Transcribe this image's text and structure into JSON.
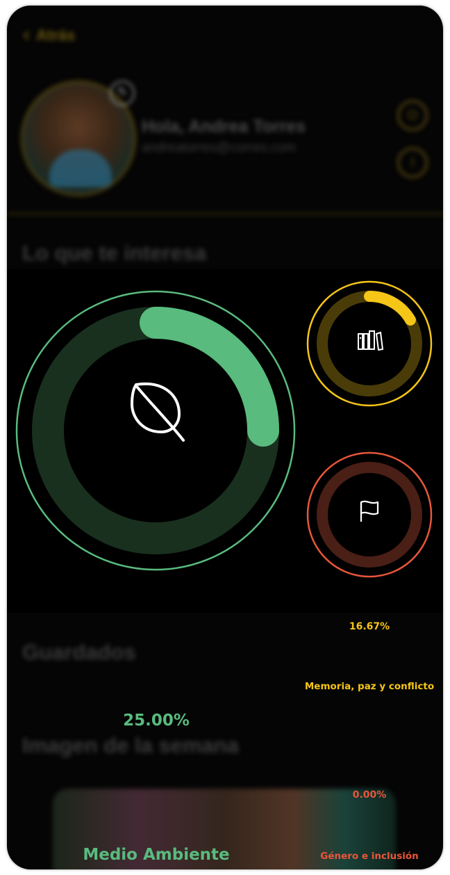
{
  "header": {
    "back_label": "Atrás"
  },
  "profile": {
    "greeting": "Hola, Andrea Torres",
    "email": "andreatorres@correo.com"
  },
  "sections": {
    "interests_title": "Lo que te interesa",
    "saved_title": "Guardados",
    "week_image_title": "Imagen de la semana"
  },
  "interests": [
    {
      "label": "Medio Ambiente",
      "percent_text": "25.00%",
      "progress": 0.25,
      "icon": "leaf-icon",
      "color": "#59bb7e",
      "track": "#19301f"
    },
    {
      "label": "Memoria, paz y conflicto",
      "percent_text": "16.67%",
      "progress": 0.1667,
      "icon": "books-icon",
      "color": "#f5c518",
      "track": "#4a3c08"
    },
    {
      "label": "Género e inclusión",
      "percent_text": "0.00%",
      "progress": 0,
      "icon": "flag-icon",
      "color": "#e8563a",
      "track": "#4a1f16"
    }
  ]
}
